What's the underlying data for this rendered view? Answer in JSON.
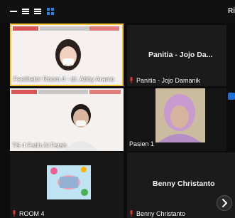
{
  "window": {
    "controls": [
      "minimize-icon",
      "menu-icon",
      "grid-view-icon"
    ],
    "right_edge_label": "Ri"
  },
  "participants": [
    {
      "label": "Fasilitator Room 4 - dr. Abby Aramo",
      "type": "video"
    },
    {
      "label": "Panitia - Jojo Damanik",
      "display_name": "Panitia - Jojo Da...",
      "type": "name-only",
      "muted": true
    },
    {
      "label": "TS 4 Fatih Al Fatah",
      "type": "video"
    },
    {
      "label": "Pasien 1",
      "type": "video"
    },
    {
      "label": "ROOM 4",
      "type": "video",
      "muted": true
    },
    {
      "label": "Benny Christanto",
      "display_name": "Benny Christanto",
      "type": "name-only",
      "muted": true
    }
  ],
  "colors": {
    "background": "#0c0c0c",
    "active_speaker_border": "#f1c232",
    "mic_muted": "#e53935",
    "blue_marker": "#1e6fd9"
  }
}
